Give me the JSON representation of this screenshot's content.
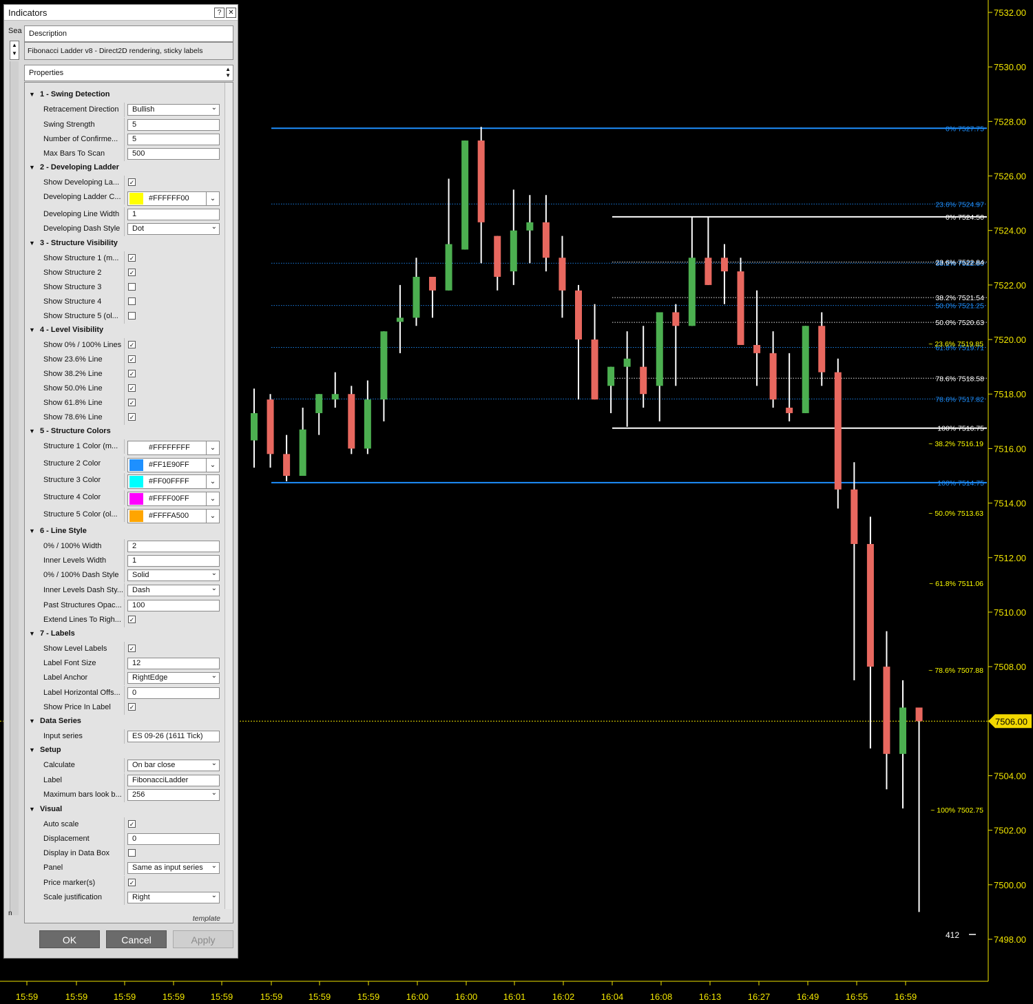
{
  "dialog": {
    "title": "Indicators",
    "help_icon": "?",
    "close_icon": "✕",
    "search_label": "Sea",
    "strip_label": "n",
    "description_header": "Description",
    "description_text": "Fibonacci Ladder v8 - Direct2D rendering, sticky labels",
    "properties_header": "Properties",
    "template_link": "template",
    "buttons": {
      "ok": "OK",
      "cancel": "Cancel",
      "apply": "Apply"
    }
  },
  "properties": [
    {
      "kind": "cat",
      "label": "1 - Swing Detection"
    },
    {
      "kind": "select",
      "label": "Retracement Direction",
      "value": "Bullish"
    },
    {
      "kind": "text",
      "label": "Swing Strength",
      "value": "5"
    },
    {
      "kind": "text",
      "label": "Number of Confirme...",
      "value": "5"
    },
    {
      "kind": "text",
      "label": "Max Bars To Scan",
      "value": "500"
    },
    {
      "kind": "cat",
      "label": "2 - Developing Ladder"
    },
    {
      "kind": "check",
      "label": "Show Developing La...",
      "checked": true
    },
    {
      "kind": "color",
      "label": "Developing Ladder C...",
      "value": "#FFFFFF00",
      "swatch": "#FFFF00"
    },
    {
      "kind": "text",
      "label": "Developing Line Width",
      "value": "1"
    },
    {
      "kind": "select",
      "label": "Developing Dash Style",
      "value": "Dot"
    },
    {
      "kind": "cat",
      "label": "3 - Structure Visibility"
    },
    {
      "kind": "check",
      "label": "Show Structure 1 (m...",
      "checked": true
    },
    {
      "kind": "check",
      "label": "Show Structure 2",
      "checked": true
    },
    {
      "kind": "check",
      "label": "Show Structure 3",
      "checked": false
    },
    {
      "kind": "check",
      "label": "Show Structure 4",
      "checked": false
    },
    {
      "kind": "check",
      "label": "Show Structure 5 (ol...",
      "checked": false
    },
    {
      "kind": "cat",
      "label": "4 - Level Visibility"
    },
    {
      "kind": "check",
      "label": "Show 0% / 100% Lines",
      "checked": true
    },
    {
      "kind": "check",
      "label": "Show 23.6% Line",
      "checked": true
    },
    {
      "kind": "check",
      "label": "Show 38.2% Line",
      "checked": true
    },
    {
      "kind": "check",
      "label": "Show 50.0% Line",
      "checked": true
    },
    {
      "kind": "check",
      "label": "Show 61.8% Line",
      "checked": true
    },
    {
      "kind": "check",
      "label": "Show 78.6% Line",
      "checked": true
    },
    {
      "kind": "cat",
      "label": "5 - Structure Colors"
    },
    {
      "kind": "color",
      "label": "Structure 1 Color (m...",
      "value": "#FFFFFFFF",
      "swatch": "#FFFFFF"
    },
    {
      "kind": "color",
      "label": "Structure 2 Color",
      "value": "#FF1E90FF",
      "swatch": "#1E90FF"
    },
    {
      "kind": "color",
      "label": "Structure 3 Color",
      "value": "#FF00FFFF",
      "swatch": "#00FFFF"
    },
    {
      "kind": "color",
      "label": "Structure 4 Color",
      "value": "#FFFF00FF",
      "swatch": "#FF00FF"
    },
    {
      "kind": "color",
      "label": "Structure 5 Color (ol...",
      "value": "#FFFFA500",
      "swatch": "#FFA500"
    },
    {
      "kind": "cat",
      "label": "6 - Line Style"
    },
    {
      "kind": "text",
      "label": "0% / 100% Width",
      "value": "2"
    },
    {
      "kind": "text",
      "label": "Inner Levels Width",
      "value": "1"
    },
    {
      "kind": "select",
      "label": "0% / 100% Dash Style",
      "value": "Solid"
    },
    {
      "kind": "select",
      "label": "Inner Levels Dash Sty...",
      "value": "Dash"
    },
    {
      "kind": "text",
      "label": "Past Structures Opac...",
      "value": "100"
    },
    {
      "kind": "check",
      "label": "Extend Lines To Righ...",
      "checked": true
    },
    {
      "kind": "cat",
      "label": "7 - Labels"
    },
    {
      "kind": "check",
      "label": "Show Level Labels",
      "checked": true
    },
    {
      "kind": "text",
      "label": "Label Font Size",
      "value": "12"
    },
    {
      "kind": "select",
      "label": "Label Anchor",
      "value": "RightEdge"
    },
    {
      "kind": "text",
      "label": "Label Horizontal Offs...",
      "value": "0"
    },
    {
      "kind": "check",
      "label": "Show Price In Label",
      "checked": true
    },
    {
      "kind": "cat",
      "label": "Data Series"
    },
    {
      "kind": "text",
      "label": "Input series",
      "value": "ES 09-26 (1611 Tick)"
    },
    {
      "kind": "cat",
      "label": "Setup"
    },
    {
      "kind": "select",
      "label": "Calculate",
      "value": "On bar close"
    },
    {
      "kind": "text",
      "label": "Label",
      "value": "FibonacciLadder"
    },
    {
      "kind": "select",
      "label": "Maximum bars look b...",
      "value": "256"
    },
    {
      "kind": "cat",
      "label": "Visual"
    },
    {
      "kind": "check",
      "label": "Auto scale",
      "checked": true
    },
    {
      "kind": "text",
      "label": "Displacement",
      "value": "0"
    },
    {
      "kind": "check",
      "label": "Display in Data Box",
      "checked": false
    },
    {
      "kind": "select",
      "label": "Panel",
      "value": "Same as input series"
    },
    {
      "kind": "check",
      "label": "Price marker(s)",
      "checked": true
    },
    {
      "kind": "select",
      "label": "Scale justification",
      "value": "Right"
    }
  ],
  "chart_data": {
    "type": "candlestick",
    "y_axis_ticks": [
      "7532.00",
      "7530.00",
      "7528.00",
      "7526.00",
      "7524.00",
      "7522.00",
      "7520.00",
      "7518.00",
      "7516.00",
      "7514.00",
      "7512.00",
      "7510.00",
      "7508.00",
      "7506.00",
      "7504.00",
      "7502.00",
      "7500.00",
      "7498.00"
    ],
    "x_axis_ticks": [
      "15:59",
      "15:59",
      "15:59",
      "15:59",
      "15:59",
      "15:59",
      "15:59",
      "15:59",
      "16:00",
      "16:00",
      "16:01",
      "16:02",
      "16:04",
      "16:08",
      "16:13",
      "16:27",
      "16:49",
      "16:55",
      "16:59"
    ],
    "ylim": [
      7497.5,
      7532.3
    ],
    "current_price": "7506.00",
    "bar_counter": "412",
    "colors": {
      "up": "#4caf50",
      "down": "#e8685f",
      "axis": "#f2e600",
      "structure_blue": "#1e90ff",
      "structure_white": "#ffffff",
      "dev_yellow": "#ffff00"
    },
    "candles": [
      {
        "o": 7516.3,
        "h": 7518.2,
        "l": 7515.3,
        "c": 7517.3
      },
      {
        "o": 7517.8,
        "h": 7518.0,
        "l": 7515.3,
        "c": 7515.8
      },
      {
        "o": 7515.8,
        "h": 7516.5,
        "l": 7514.8,
        "c": 7515.0
      },
      {
        "o": 7515.0,
        "h": 7517.5,
        "l": 7515.0,
        "c": 7516.7
      },
      {
        "o": 7517.3,
        "h": 7518.0,
        "l": 7516.5,
        "c": 7518.0
      },
      {
        "o": 7517.8,
        "h": 7518.8,
        "l": 7517.5,
        "c": 7518.0
      },
      {
        "o": 7518.0,
        "h": 7518.3,
        "l": 7515.8,
        "c": 7516.0
      },
      {
        "o": 7516.0,
        "h": 7518.5,
        "l": 7515.8,
        "c": 7517.8
      },
      {
        "o": 7517.8,
        "h": 7520.3,
        "l": 7517.0,
        "c": 7520.3
      },
      {
        "o": 7520.8,
        "h": 7522.0,
        "l": 7519.5,
        "c": 7520.8
      },
      {
        "o": 7520.8,
        "h": 7523.0,
        "l": 7520.5,
        "c": 7522.3
      },
      {
        "o": 7522.3,
        "h": 7522.3,
        "l": 7520.8,
        "c": 7521.8
      },
      {
        "o": 7521.8,
        "h": 7525.9,
        "l": 7521.8,
        "c": 7523.5
      },
      {
        "o": 7523.3,
        "h": 7527.3,
        "l": 7523.3,
        "c": 7527.3
      },
      {
        "o": 7527.3,
        "h": 7527.8,
        "l": 7522.8,
        "c": 7524.3
      },
      {
        "o": 7523.8,
        "h": 7523.8,
        "l": 7521.8,
        "c": 7522.3
      },
      {
        "o": 7522.5,
        "h": 7525.5,
        "l": 7522.0,
        "c": 7524.0
      },
      {
        "o": 7524.0,
        "h": 7525.3,
        "l": 7522.8,
        "c": 7524.3
      },
      {
        "o": 7524.3,
        "h": 7525.3,
        "l": 7522.5,
        "c": 7523.0
      },
      {
        "o": 7523.0,
        "h": 7523.8,
        "l": 7520.8,
        "c": 7521.8
      },
      {
        "o": 7521.8,
        "h": 7522.0,
        "l": 7517.8,
        "c": 7520.0
      },
      {
        "o": 7520.0,
        "h": 7521.3,
        "l": 7517.8,
        "c": 7517.8
      },
      {
        "o": 7518.3,
        "h": 7519.0,
        "l": 7517.3,
        "c": 7519.0
      },
      {
        "o": 7519.0,
        "h": 7520.3,
        "l": 7516.8,
        "c": 7519.3
      },
      {
        "o": 7519.0,
        "h": 7520.5,
        "l": 7517.5,
        "c": 7518.0
      },
      {
        "o": 7518.3,
        "h": 7521.0,
        "l": 7517.0,
        "c": 7521.0
      },
      {
        "o": 7521.0,
        "h": 7521.3,
        "l": 7518.3,
        "c": 7520.5
      },
      {
        "o": 7520.5,
        "h": 7524.5,
        "l": 7520.5,
        "c": 7523.0
      },
      {
        "o": 7523.0,
        "h": 7524.5,
        "l": 7522.0,
        "c": 7522.0
      },
      {
        "o": 7523.0,
        "h": 7523.5,
        "l": 7521.3,
        "c": 7522.5
      },
      {
        "o": 7522.5,
        "h": 7523.0,
        "l": 7521.3,
        "c": 7519.8
      },
      {
        "o": 7519.8,
        "h": 7521.8,
        "l": 7518.3,
        "c": 7519.5
      },
      {
        "o": 7519.5,
        "h": 7520.3,
        "l": 7517.5,
        "c": 7517.8
      },
      {
        "o": 7517.5,
        "h": 7519.5,
        "l": 7517.0,
        "c": 7517.3
      },
      {
        "o": 7517.3,
        "h": 7520.5,
        "l": 7517.3,
        "c": 7520.5
      },
      {
        "o": 7520.5,
        "h": 7521.0,
        "l": 7518.3,
        "c": 7518.8
      },
      {
        "o": 7518.8,
        "h": 7519.3,
        "l": 7513.8,
        "c": 7514.5
      },
      {
        "o": 7514.5,
        "h": 7515.5,
        "l": 7507.5,
        "c": 7512.5
      },
      {
        "o": 7512.5,
        "h": 7513.5,
        "l": 7505.0,
        "c": 7508.0
      },
      {
        "o": 7508.0,
        "h": 7509.3,
        "l": 7503.5,
        "c": 7504.8
      },
      {
        "o": 7504.8,
        "h": 7507.5,
        "l": 7502.8,
        "c": 7506.5
      },
      {
        "o": 7506.5,
        "h": 7506.5,
        "l": 7499.0,
        "c": 7506.0
      }
    ],
    "levels": [
      {
        "price": 7527.75,
        "style": "solid",
        "color": "#1e90ff",
        "width": 2,
        "label": "0%",
        "value": "7527.75",
        "x_start": 394
      },
      {
        "price": 7524.97,
        "style": "dotted",
        "color": "#1e90ff",
        "width": 1,
        "label": "23.6%",
        "value": "7524.97",
        "x_start": 394
      },
      {
        "price": 7522.8,
        "style": "dotted",
        "color": "#1e90ff",
        "width": 1,
        "label": "38.2%",
        "value": "7522.80",
        "x_start": 394
      },
      {
        "price": 7521.25,
        "style": "dotted",
        "color": "#1e90ff",
        "width": 1,
        "label": "50.0%",
        "value": "7521.25",
        "x_start": 394
      },
      {
        "price": 7519.71,
        "style": "dotted",
        "color": "#1e90ff",
        "width": 1,
        "label": "61.8%",
        "value": "7519.71",
        "x_start": 394
      },
      {
        "price": 7517.82,
        "style": "dotted",
        "color": "#1e90ff",
        "width": 1,
        "label": "78.6%",
        "value": "7517.82",
        "x_start": 394
      },
      {
        "price": 7514.75,
        "style": "solid",
        "color": "#1e90ff",
        "width": 2,
        "label": "100%",
        "value": "7514.75",
        "x_start": 394
      },
      {
        "price": 7524.5,
        "style": "solid",
        "color": "#ffffff",
        "width": 2,
        "label": "0%",
        "value": "7524.50",
        "x_start": 889
      },
      {
        "price": 7522.84,
        "style": "dotted",
        "color": "#ffffff",
        "width": 1,
        "label": "23.6%",
        "value": "7522.84",
        "x_start": 889
      },
      {
        "price": 7521.54,
        "style": "dotted",
        "color": "#ffffff",
        "width": 1,
        "label": "38.2%",
        "value": "7521.54",
        "x_start": 889
      },
      {
        "price": 7520.63,
        "style": "dotted",
        "color": "#ffffff",
        "width": 1,
        "label": "50.0%",
        "value": "7520.63",
        "x_start": 889
      },
      {
        "price": 7518.58,
        "style": "dotted",
        "color": "#ffffff",
        "width": 1,
        "label": "78.6%",
        "value": "7518.58",
        "x_start": 889
      },
      {
        "price": 7516.75,
        "style": "solid",
        "color": "#ffffff",
        "width": 2,
        "label": "100%",
        "value": "7516.75",
        "x_start": 889
      }
    ],
    "developing_labels": [
      {
        "price": 7519.85,
        "label": "~ 23.6%",
        "value": "7519.85"
      },
      {
        "price": 7516.19,
        "label": "~ 38.2%",
        "value": "7516.19"
      },
      {
        "price": 7513.63,
        "label": "~ 50.0%",
        "value": "7513.63"
      },
      {
        "price": 7511.06,
        "label": "~ 61.8%",
        "value": "7511.06"
      },
      {
        "price": 7507.88,
        "label": "~ 78.6%",
        "value": "7507.88"
      },
      {
        "price": 7502.75,
        "label": "~ 100%",
        "value": "7502.75"
      }
    ]
  }
}
